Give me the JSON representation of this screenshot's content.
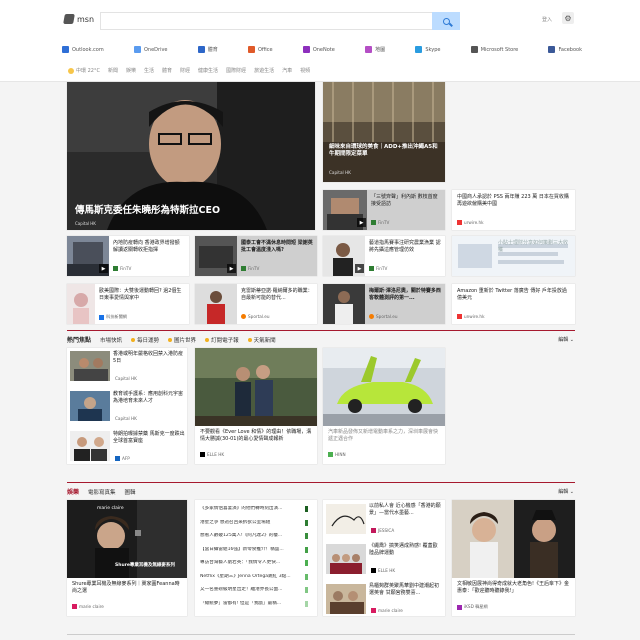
{
  "header": {
    "brand": "msn",
    "signin": "登入",
    "services": [
      {
        "label": "Outlook.com",
        "color": "#2f6fd6",
        "icon": "outlook-icon"
      },
      {
        "label": "OneDrive",
        "color": "#5a9bef",
        "icon": "onedrive-icon"
      },
      {
        "label": "體育",
        "color": "#2d66c8",
        "icon": "sports-icon"
      },
      {
        "label": "Office",
        "color": "#e05a29",
        "icon": "office-icon"
      },
      {
        "label": "OneNote",
        "color": "#8d2fbd",
        "icon": "onenote-icon"
      },
      {
        "label": "地圖",
        "color": "#b44ec5",
        "icon": "maps-icon"
      },
      {
        "label": "Skype",
        "color": "#2a9ce0",
        "icon": "skype-icon"
      },
      {
        "label": "Microsoft Store",
        "color": "#555",
        "icon": "store-icon"
      },
      {
        "label": "Facebook",
        "color": "#3b5998",
        "icon": "facebook-icon"
      }
    ],
    "weather": "中環 22°C",
    "categories": [
      "新聞",
      "娛樂",
      "生活",
      "體育",
      "財經",
      "健康生活",
      "國際財經",
      "旅遊生活",
      "汽車",
      "視頻"
    ]
  },
  "hero": {
    "title": "傳馬斯克委任朱曉彤為特斯拉CEO",
    "source": "Capital HK"
  },
  "feature": {
    "title": "細味來自環球的美食｜ADD+推出沖繩A5和牛期間限定菜單",
    "source": "Capital HK"
  },
  "row1": [
    {
      "title": "「三號齊聲」利內斯 數枝首度接受語訪",
      "source": "FinTV"
    },
    {
      "title": "中國商人承認於 PSS 兩年賺 223 萬 日本在買收購再遊欲僱購美中國",
      "source": "urwire.hk"
    }
  ],
  "row2": [
    {
      "title": "內地防疫轉向 香港政界增撥額 解讀返關轉收拒指揮",
      "source": "FinTV"
    },
    {
      "title": "國泰工會不滿休息時間短 梁謝英批工會溫度淺入嗎?",
      "source": "FinTV"
    },
    {
      "title": "藝道指馬賽事注研究農業漁業 認將先攝這應管理仿效",
      "source": "FinTV"
    },
    {
      "title": "小貼士理財分享如何策劃三大收穫",
      "source": "MoneyHK"
    }
  ],
  "row3": [
    {
      "title": "歐美國際：大雙後運動轉回? 過2個生日東事愛情與家中",
      "source": "科技新聞網"
    },
    {
      "title": "克雷斯蒂亞諾·羅納爾多的職業：自最新可能的替代...",
      "source": "Sportal.eu"
    },
    {
      "title": "梅爾斯·澤洛尼奧，關於特賽多西客軟體測評的第一...",
      "source": "Sportal.eu"
    },
    {
      "title": "Amazon 重新於 Twitter 落廣告 傳好 戶年投放過億美元",
      "source": "unwire.hk"
    }
  ],
  "hot": {
    "title": "熱門焦點",
    "tabs": [
      "市場快訊",
      "每日運勢",
      "圖片世界",
      "訂閱電子報",
      "天氣新聞"
    ],
    "edit": "編輯",
    "list": [
      {
        "title": "香港或明年嚴格收回禁入港防疫5日",
        "source": "Capital HK"
      },
      {
        "title": "教育城手護系：應用創科元宇宙 為港培育未來人才",
        "source": "Capital HK"
      },
      {
        "title": "特朗拍曝據禁藥 馬斯克一度跌出全球首富寶座",
        "source": "AFP"
      }
    ],
    "couple": {
      "title": "不要觀看《Ever Love 和情》的理由！依職場，溝情大勝誠(30-01)的最心愛情聲成報新",
      "source": "ELLE HK"
    },
    "car": {
      "title": "汽車新品發佈又新增電動車系之力，深圳車展會快遞正遇合作",
      "source": "HINN"
    }
  },
  "ent": {
    "title": "娛樂",
    "tabs": [
      "電影寫真集",
      "圖輯"
    ],
    "edit": "編輯",
    "mc": {
      "title": "Shure專業耳機及無線麥系列｜冀家圓Feanna時尚之選",
      "source": "marie claire",
      "badge": "marie claire",
      "caption": "Shure專業耳機及無線麥系列"
    },
    "list": [
      "《多家情侶喜宴演》的他們轉時刻出演...",
      "港星之爭 想逝召回來拆欲公室場組",
      "想看人數破125萬人!《阿凡達2》的樓...",
      "【當日攝雷組16強】新零食推介！稱盛...",
      "專訪台灣藝人劉若英：「我情令人更快...",
      "Netflix《星期三》Jenna Ortega跳紅 3點...",
      "又一名重磅級明星出走！離港界長公面...",
      "「總統夢」雷都有! 但是「我戲」最稱..."
    ],
    "mid": [
      {
        "title": "以前私人會 近心機感「香港的願景」—當代水墨藝...",
        "source": "JESSICA"
      },
      {
        "title": "《繩喬》搞笑邁成熟感! 覆蓋歐陸品牌運動",
        "source": "ELLE HK"
      },
      {
        "title": "鳥櫃夠群英聚馬華劉中建潮起初選英會 甘願宮務雙喜...",
        "source": "marie claire"
      }
    ],
    "kdrama": {
      "title": "文相敏因展神尚得奇成就大老角色!《王后傘下》金惠泰：「歡迎聽時聽錄我!」",
      "source": "iKSD 韓星網"
    }
  }
}
